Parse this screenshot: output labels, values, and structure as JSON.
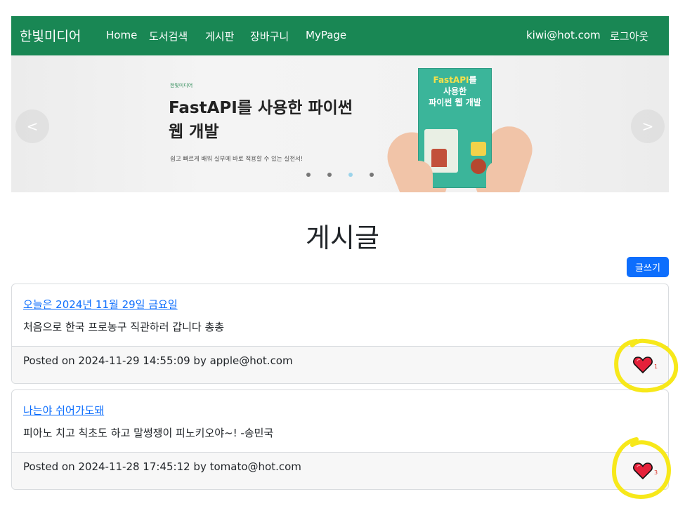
{
  "navbar": {
    "brand": "한빛미디어",
    "links": [
      "Home",
      "도서검색",
      "게시판",
      "장바구니",
      "MyPage"
    ],
    "user_email": "kiwi@hot.com",
    "logout": "로그아웃",
    "bg_color": "#198754"
  },
  "carousel": {
    "publisher": "한빛미디어",
    "title_line1": "FastAPI를 사용한 파이썬",
    "title_line2": "웹 개발",
    "subtitle": "쉽고 빠르게 배워 실무에 바로 적용할 수 있는 실전서!",
    "book_title_line1_yellow": "FastAPI",
    "book_title_line1_white": "를",
    "book_title_line2": "사용한",
    "book_title_line3": "파이썬 웹 개발",
    "prev_icon": "<",
    "next_icon": ">",
    "slide_count": 4,
    "active_slide": 3
  },
  "page": {
    "title": "게시글",
    "write_button": "글쓰기"
  },
  "posts": [
    {
      "title": "오늘은 2024년 11월 29일 금요일",
      "content": "처음으로 한국 프로농구 직관하러 갑니다 총총",
      "footer": "Posted on 2024-11-29 14:55:09 by apple@hot.com",
      "likes": "1",
      "like_icon": "heart-icon"
    },
    {
      "title": "나는야 쉬어가도돼",
      "content": "피아노 치고 칙초도 하고 말썽쟁이 피노키오야~! -송민국",
      "footer": "Posted on 2024-11-28 17:45:12 by tomato@hot.com",
      "likes": "3",
      "like_icon": "heart-icon"
    }
  ],
  "colors": {
    "link": "#0d6efd",
    "heart": "#e5213a",
    "highlight": "#f7e81a"
  }
}
